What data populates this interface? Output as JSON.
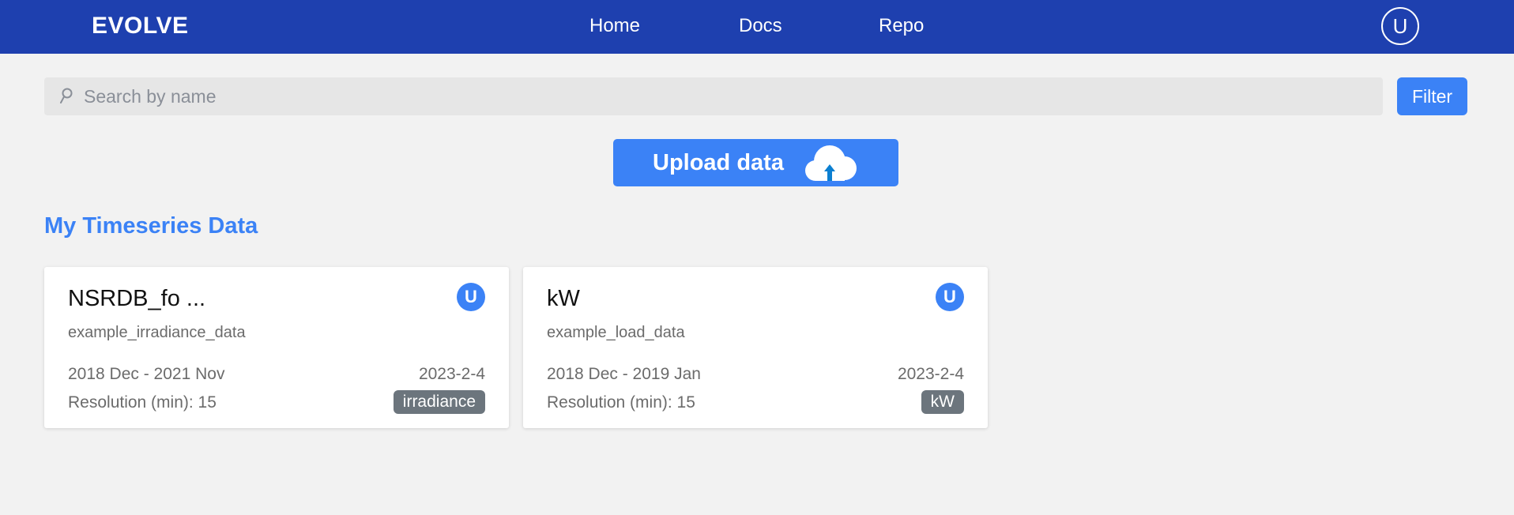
{
  "navbar": {
    "brand": "EVOLVE",
    "links": [
      "Home",
      "Docs",
      "Repo"
    ],
    "avatar_initial": "U",
    "background": "#1e40af"
  },
  "search": {
    "placeholder": "Search by name",
    "value": "",
    "icon": "search-icon",
    "filter_label": "Filter"
  },
  "upload": {
    "label": "Upload data",
    "icon": "cloud-upload-icon"
  },
  "section": {
    "title": "My Timeseries Data"
  },
  "cards": [
    {
      "title": "NSRDB_fo ...",
      "owner_initial": "U",
      "subtitle": "example_irradiance_data",
      "range": "2018 Dec - 2021 Nov",
      "date": "2023-2-4",
      "resolution": "Resolution (min): 15",
      "tag": "irradiance"
    },
    {
      "title": "kW",
      "owner_initial": "U",
      "subtitle": "example_load_data",
      "range": "2018 Dec - 2019 Jan",
      "date": "2023-2-4",
      "resolution": "Resolution (min): 15",
      "tag": "kW"
    }
  ],
  "colors": {
    "accent": "#3b82f6",
    "page_background": "#f2f2f2",
    "tag_background": "#6c757d"
  }
}
